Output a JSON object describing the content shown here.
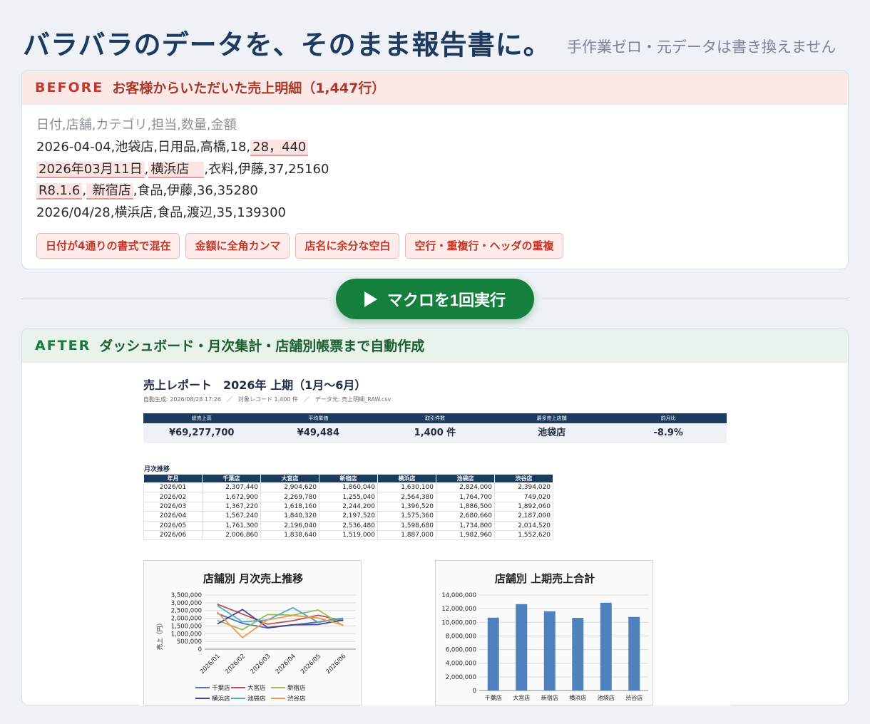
{
  "hero": {
    "title": "バラバラのデータを、そのまま報告書に。",
    "subtitle": "手作業ゼロ・元データは書き換えません"
  },
  "before": {
    "tag": "BEFORE",
    "title": "お客様からいただいた売上明細（1,447行）",
    "csv_header": "日付,店舗,カテゴリ,担当,数量,金額",
    "row1": {
      "pre": "2026-04-04,池袋店,日用品,高橋,18,",
      "amount": "28，440"
    },
    "row2": {
      "date": "2026年03月11日",
      "sep": ",",
      "store": "横浜店　",
      "rest": ",衣料,伊藤,37,25160"
    },
    "row3": {
      "date": "R8.1.6",
      "sep": ",",
      "store": " 新宿店",
      "rest": ",食品,伊藤,36,35280"
    },
    "row4": "2026/04/28,横浜店,食品,渡辺,35,139300",
    "issues": [
      "日付が4通りの書式で混在",
      "金額に全角カンマ",
      "店名に余分な空白",
      "空行・重複行・ヘッダの重複"
    ]
  },
  "action": {
    "run_label": "マクロを1回実行"
  },
  "after": {
    "tag": "AFTER",
    "title": "ダッシュボード・月次集計・店舗別帳票まで自動作成"
  },
  "report": {
    "title": "売上レポート　2026年 上期（1月〜6月）",
    "meta": "自動生成: 2026/08/28 17:26　／　対象レコード 1,400 件　／　データ元: 売上明細_RAW.csv",
    "kpis": [
      {
        "label": "総売上高",
        "value": "¥69,277,700"
      },
      {
        "label": "平均単価",
        "value": "¥49,484"
      },
      {
        "label": "取引件数",
        "value": "1,400 件"
      },
      {
        "label": "最多売上店舗",
        "value": "池袋店"
      },
      {
        "label": "前月比",
        "value": "-8.9%"
      }
    ],
    "monthly_label": "月次推移",
    "table_headers": [
      "年月",
      "千葉店",
      "大宮店",
      "新宿店",
      "横浜店",
      "池袋店",
      "渋谷店"
    ],
    "table_rows": [
      [
        "2026/01",
        "2,307,440",
        "2,904,620",
        "1,860,040",
        "1,630,100",
        "2,824,000",
        "2,394,020"
      ],
      [
        "2026/02",
        "1,672,900",
        "2,269,780",
        "1,255,040",
        "2,564,380",
        "1,764,700",
        "749,020"
      ],
      [
        "2026/03",
        "1,367,220",
        "1,618,160",
        "2,244,200",
        "1,396,520",
        "1,886,500",
        "1,892,060"
      ],
      [
        "2026/04",
        "1,567,240",
        "1,840,320",
        "2,197,520",
        "1,575,360",
        "2,680,660",
        "2,187,000"
      ],
      [
        "2026/05",
        "1,761,300",
        "2,196,040",
        "2,536,480",
        "1,598,680",
        "1,734,800",
        "2,014,520"
      ],
      [
        "2026/06",
        "2,006,860",
        "1,838,640",
        "1,519,000",
        "1,887,000",
        "1,982,960",
        "1,552,620"
      ]
    ]
  },
  "chart_data": [
    {
      "type": "line",
      "title": "店舗別 月次売上推移",
      "xlabel": "",
      "ylabel": "売上（円）",
      "x": [
        "2026/01",
        "2026/02",
        "2026/03",
        "2026/04",
        "2026/05",
        "2026/06"
      ],
      "ylim": [
        0,
        3500000
      ],
      "yticks": [
        "0",
        "500,000",
        "1,000,000",
        "1,500,000",
        "2,000,000",
        "2,500,000",
        "3,000,000",
        "3,500,000"
      ],
      "legend_position": "bottom",
      "series": [
        {
          "name": "千葉店",
          "color": "#4e79b7",
          "values": [
            2307440,
            1672900,
            1367220,
            1567240,
            1761300,
            2006860
          ]
        },
        {
          "name": "大宮店",
          "color": "#c0504d",
          "values": [
            2904620,
            2269780,
            1618160,
            1840320,
            2196040,
            1838640
          ]
        },
        {
          "name": "新宿店",
          "color": "#9bbb59",
          "values": [
            1860040,
            1255040,
            2244200,
            2197520,
            2536480,
            1519000
          ]
        },
        {
          "name": "横浜店",
          "color": "#4b3f8f",
          "values": [
            1630100,
            2564380,
            1396520,
            1575360,
            1598680,
            1887000
          ]
        },
        {
          "name": "池袋店",
          "color": "#4bacc6",
          "values": [
            2824000,
            1764700,
            1886500,
            2680660,
            1734800,
            1982960
          ]
        },
        {
          "name": "渋谷店",
          "color": "#f79646",
          "values": [
            2394020,
            749020,
            1892060,
            2187000,
            2014520,
            1552620
          ]
        }
      ]
    },
    {
      "type": "bar",
      "title": "店舗別 上期売上合計",
      "xlabel": "",
      "ylabel": "",
      "categories": [
        "千葉店",
        "大宮店",
        "新宿店",
        "横浜店",
        "池袋店",
        "渋谷店"
      ],
      "values": [
        10682960,
        12667560,
        11612280,
        10652040,
        12873620,
        10789240
      ],
      "ylim": [
        0,
        14000000
      ],
      "yticks": [
        "0",
        "2,000,000",
        "4,000,000",
        "6,000,000",
        "8,000,000",
        "10,000,000",
        "12,000,000",
        "14,000,000"
      ],
      "bar_color": "#4f81bd"
    }
  ]
}
